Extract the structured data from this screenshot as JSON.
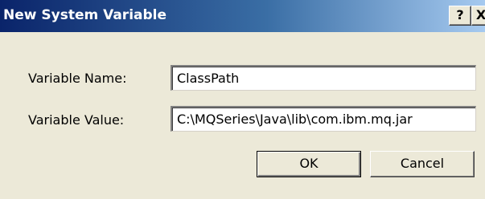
{
  "window": {
    "title": "New System Variable",
    "help_glyph": "?",
    "close_glyph": "X"
  },
  "form": {
    "name_label": "Variable Name:",
    "name_value": "ClassPath",
    "value_label": "Variable Value:",
    "value_value": "C:\\MQSeries\\Java\\lib\\com.ibm.mq.jar"
  },
  "buttons": {
    "ok_label": "OK",
    "cancel_label": "Cancel"
  },
  "colors": {
    "title_active": "#0a246a",
    "title_gradient_end": "#a6caf0",
    "dialog_face": "#ece9d8"
  }
}
